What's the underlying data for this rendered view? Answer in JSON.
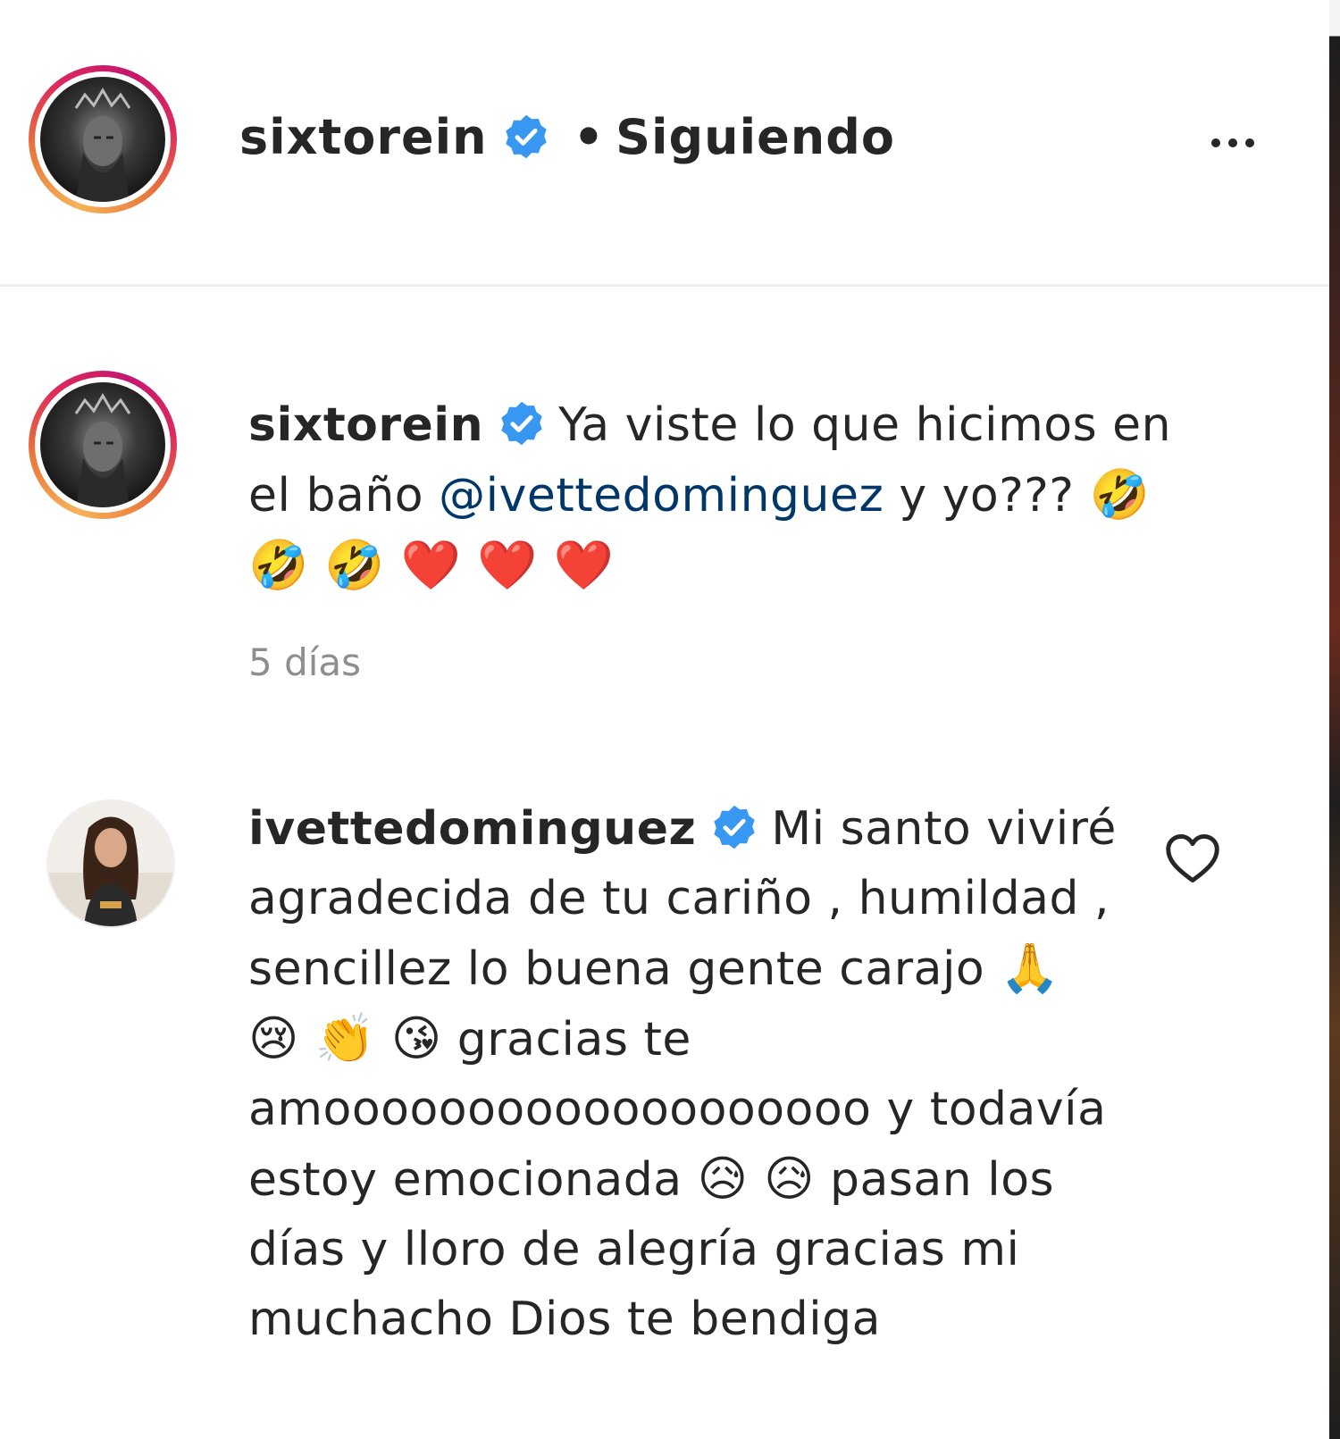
{
  "header": {
    "username": "sixtorein",
    "separator": "•",
    "follow_status": "Siguiendo",
    "more_icon": "more-horizontal-icon"
  },
  "caption": {
    "username": "sixtorein",
    "text_before_mention": "Ya viste lo que hicimos en el baño",
    "mention": "@ivettedominguez",
    "text_after_mention": "y yo???",
    "emojis": "🤣 🤣 🤣 ❤️ ❤️ ❤️",
    "time": "5 días"
  },
  "comment": {
    "username": "ivettedominguez",
    "text_1": "Mi santo viviré agradecida de tu cariño , humildad , sencillez lo buena gente carajo",
    "emojis_1": "🙏 😢 👏 😘",
    "text_2": "gracias te amooooooooooooooooooo y todavía estoy emocionada",
    "emojis_2": "😥 😥",
    "text_3": "pasan los días y lloro de alegría gracias mi muchacho Dios te bendiga",
    "like_icon": "heart-outline-icon"
  },
  "colors": {
    "verified_blue": "#3897f0",
    "mention_blue": "#00376b",
    "text": "#262626",
    "muted": "#8e8e8e",
    "divider": "#efefef"
  }
}
